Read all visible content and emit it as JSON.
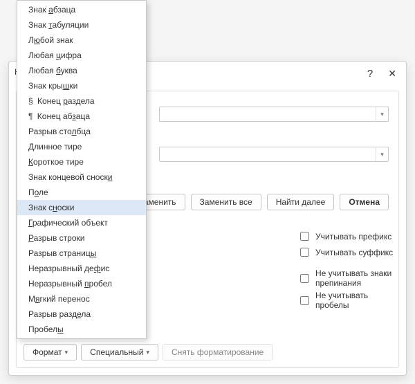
{
  "dialog": {
    "title_first_letter": "Н",
    "help": "?",
    "close": "✕"
  },
  "buttons": {
    "replace": "Заменить",
    "replace_all": "Заменить все",
    "find_next": "Найти далее",
    "cancel": "Отмена",
    "format": "Формат",
    "special": "Специальный",
    "no_format": "Снять форматирование"
  },
  "checks": {
    "prefix": "Учитывать префикс",
    "suffix": "Учитывать суффикс",
    "punct": "Не учитывать знаки препинания",
    "spaces": "Не учитывать пробелы"
  },
  "menu": {
    "items": [
      {
        "pre": "Знак ",
        "u": "а",
        "post": "бзаца"
      },
      {
        "pre": "Знак ",
        "u": "т",
        "post": "абуляции"
      },
      {
        "pre": "Л",
        "u": "ю",
        "post": "бой знак"
      },
      {
        "pre": "Любая ",
        "u": "ц",
        "post": "ифра"
      },
      {
        "pre": "Любая ",
        "u": "б",
        "post": "уква"
      },
      {
        "pre": "Знак кры",
        "u": "ш",
        "post": "ки"
      },
      {
        "sym": "§ ",
        "pre": "Конец ",
        "u": "р",
        "post": "аздела"
      },
      {
        "sym": "¶ ",
        "pre": "Конец аб",
        "u": "з",
        "post": "аца"
      },
      {
        "pre": "Разрыв сто",
        "u": "л",
        "post": "бца"
      },
      {
        "pre": "",
        "u": "Д",
        "post": "линное тире"
      },
      {
        "pre": "",
        "u": "К",
        "post": "ороткое тире"
      },
      {
        "pre": "Знак концевой сноск",
        "u": "и",
        "post": ""
      },
      {
        "pre": "П",
        "u": "о",
        "post": "ле"
      },
      {
        "pre": "Знак с",
        "u": "н",
        "post": "оски",
        "sel": true
      },
      {
        "pre": "",
        "u": "Г",
        "post": "рафический объект"
      },
      {
        "pre": "",
        "u": "Р",
        "post": "азрыв строки"
      },
      {
        "pre": "Разрыв страниц",
        "u": "ы",
        "post": ""
      },
      {
        "pre": "Неразрывный де",
        "u": "ф",
        "post": "ис"
      },
      {
        "pre": "Неразрывный ",
        "u": "п",
        "post": "робел"
      },
      {
        "pre": "М",
        "u": "я",
        "post": "гкий перенос"
      },
      {
        "pre": "Разрыв разд",
        "u": "е",
        "post": "ла"
      },
      {
        "pre": "Пробел",
        "u": "ы",
        "post": ""
      }
    ]
  }
}
